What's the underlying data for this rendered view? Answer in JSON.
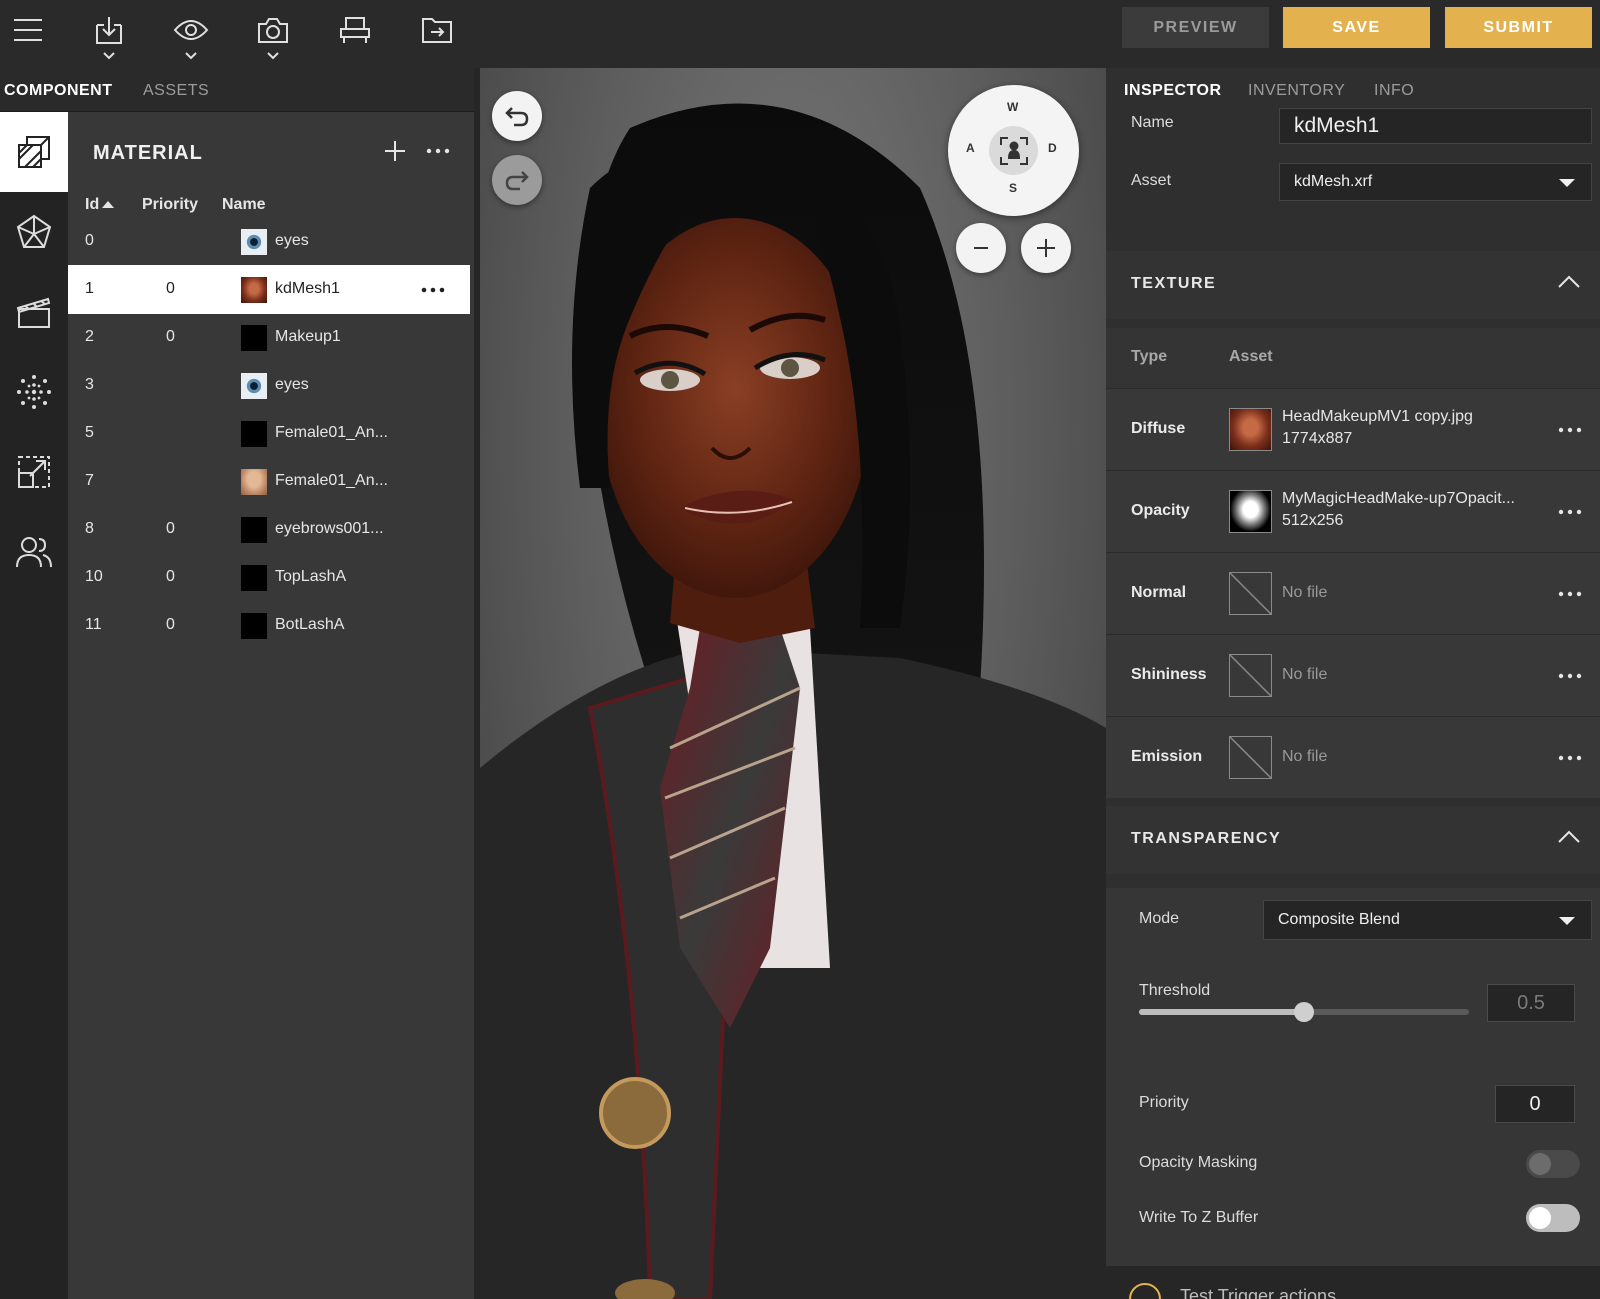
{
  "toolbar": {
    "icons": [
      "menu-icon",
      "download-icon",
      "eye-icon",
      "camera-icon",
      "chair-icon",
      "export-icon"
    ],
    "preview_label": "PREVIEW",
    "save_label": "SAVE",
    "submit_label": "SUBMIT"
  },
  "left_tabs": {
    "component": "COMPONENT",
    "assets": "ASSETS"
  },
  "sidebar": [
    "material-icon",
    "mesh-icon",
    "animation-icon",
    "particles-icon",
    "scale-icon",
    "users-icon"
  ],
  "material": {
    "title": "MATERIAL",
    "columns": {
      "id": "Id",
      "priority": "Priority",
      "name": "Name"
    },
    "rows": [
      {
        "id": "0",
        "priority": "",
        "name": "eyes",
        "thumb": "eye"
      },
      {
        "id": "1",
        "priority": "0",
        "name": "kdMesh1",
        "thumb": "face",
        "selected": true
      },
      {
        "id": "2",
        "priority": "0",
        "name": "Makeup1",
        "thumb": "black"
      },
      {
        "id": "3",
        "priority": "",
        "name": "eyes",
        "thumb": "eye"
      },
      {
        "id": "5",
        "priority": "",
        "name": "Female01_An...",
        "thumb": "black"
      },
      {
        "id": "7",
        "priority": "",
        "name": "Female01_An...",
        "thumb": "skin"
      },
      {
        "id": "8",
        "priority": "0",
        "name": "eyebrows001...",
        "thumb": "black"
      },
      {
        "id": "10",
        "priority": "0",
        "name": "TopLashA",
        "thumb": "black"
      },
      {
        "id": "11",
        "priority": "0",
        "name": "BotLashA",
        "thumb": "black"
      }
    ]
  },
  "viewport": {
    "compass": {
      "w": "W",
      "a": "A",
      "s": "S",
      "d": "D"
    }
  },
  "inspector": {
    "tabs": {
      "inspector": "INSPECTOR",
      "inventory": "INVENTORY",
      "info": "INFO"
    },
    "name_label": "Name",
    "name_value": "kdMesh1",
    "asset_label": "Asset",
    "asset_value": "kdMesh.xrf",
    "texture_title": "TEXTURE",
    "texture_cols": {
      "type": "Type",
      "asset": "Asset"
    },
    "textures": [
      {
        "type": "Diffuse",
        "file": "HeadMakeupMV1 copy.jpg",
        "size": "1774x887"
      },
      {
        "type": "Opacity",
        "file": "MyMagicHeadMake-up7Opacit...",
        "size": "512x256"
      },
      {
        "type": "Normal",
        "file": "No file",
        "size": ""
      },
      {
        "type": "Shininess",
        "file": "No file",
        "size": ""
      },
      {
        "type": "Emission",
        "file": "No file",
        "size": ""
      }
    ],
    "transparency_title": "TRANSPARENCY",
    "mode_label": "Mode",
    "mode_value": "Composite Blend",
    "threshold_label": "Threshold",
    "threshold_value": "0.5",
    "threshold_fraction": 0.5,
    "priority_label": "Priority",
    "priority_value": "0",
    "opacity_masking_label": "Opacity Masking",
    "opacity_masking_on": false,
    "write_z_label": "Write To Z Buffer",
    "write_z_on": false,
    "test_trigger": "Test Trigger actions"
  },
  "colors": {
    "accent": "#e3b24f",
    "panel": "#383838",
    "dark": "#2a2a2a"
  }
}
